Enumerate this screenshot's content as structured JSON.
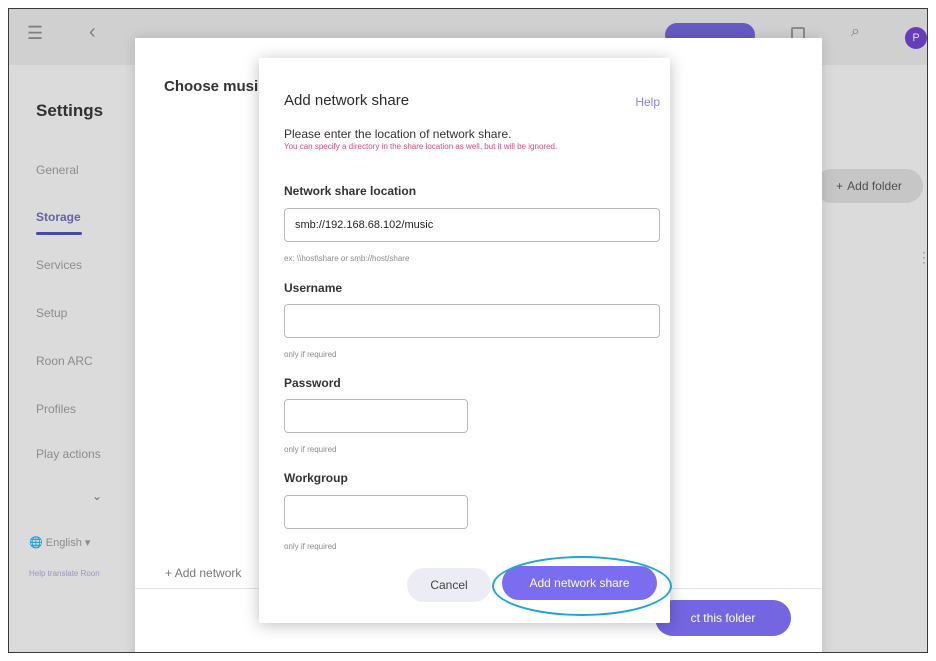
{
  "topbar": {
    "menu_icon": "hamburger-icon",
    "back_icon": "chevron-left-icon",
    "avatar_initial": "P"
  },
  "settings": {
    "title": "Settings",
    "items": [
      {
        "label": "General"
      },
      {
        "label": "Storage"
      },
      {
        "label": "Services"
      },
      {
        "label": "Setup"
      },
      {
        "label": "Roon ARC"
      },
      {
        "label": "Profiles"
      },
      {
        "label": "Play actions"
      }
    ],
    "language": "English ▾",
    "help_link": "Help translate Roon"
  },
  "storage": {
    "add_folder_label": "Add folder"
  },
  "choose_dialog": {
    "title": "Choose musi",
    "add_network_label": "Add network",
    "select_folder_label": "ct this folder"
  },
  "dialog": {
    "title": "Add network share",
    "help": "Help",
    "description": "Please enter the location of network share.",
    "note": "You can specify a directory in the share location as well, but it will be ignored.",
    "location_label": "Network share location",
    "location_value": "smb://192.168.68.102/music",
    "location_hint": "ex: \\\\host\\share or smb://host/share",
    "username_label": "Username",
    "username_value": "",
    "username_hint": "only if required",
    "password_label": "Password",
    "password_value": "",
    "password_hint": "only if required",
    "workgroup_label": "Workgroup",
    "workgroup_value": "",
    "workgroup_hint": "only if required",
    "cancel_label": "Cancel",
    "submit_label": "Add network share"
  },
  "colors": {
    "accent": "#7a6df0",
    "highlight_ring": "#1aa5e0",
    "note_text": "#d94b74"
  }
}
